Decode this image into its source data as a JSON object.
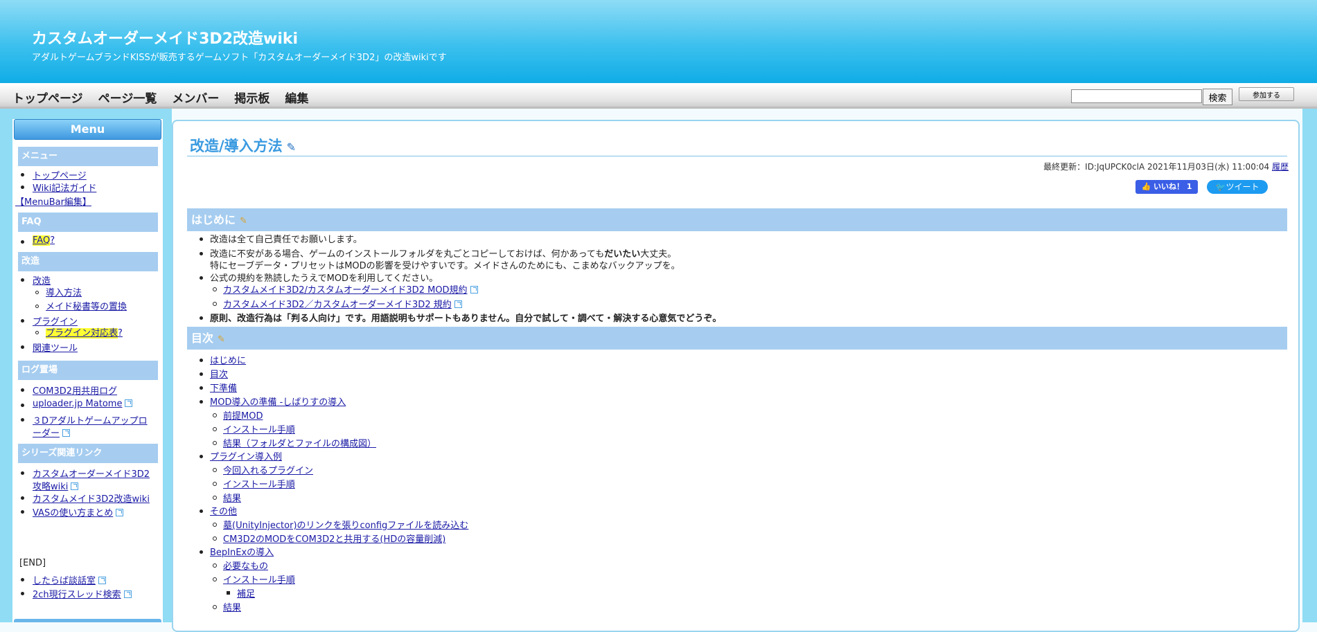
{
  "header": {
    "site_title": "カスタムオーダーメイド3D2改造wiki",
    "site_desc": "アダルトゲームブランドKISSが販売するゲームソフト「カスタムオーダーメイド3D2」の改造wikiです"
  },
  "nav": {
    "links": [
      "トップページ",
      "ページ一覧",
      "メンバー",
      "掲示板",
      "編集"
    ],
    "search_value": "",
    "search_button": "検索",
    "join_button": "参加する"
  },
  "sidebar": {
    "title": "Menu",
    "sections": [
      {
        "title": "メニュー",
        "items": [
          "トップページ",
          "Wiki記法ガイド"
        ],
        "extra": "【MenuBar編集】"
      },
      {
        "title": "FAQ",
        "items": [
          "FAQ",
          "?"
        ]
      },
      {
        "title": "改造",
        "items": [
          "改造",
          "導入方法",
          "メイド秘書等の置換",
          "プラグイン",
          "プラグイン対応表",
          "?",
          "関連ツール"
        ]
      },
      {
        "title": "ログ置場",
        "items": [
          "COM3D2用共用ログ",
          "uploader.jp Matome",
          "３Dアダルトゲームアップロ",
          "ーダー"
        ]
      },
      {
        "title": "シリーズ関連リンク",
        "items": [
          "カスタムオーダーメイド3D2",
          "攻略wiki",
          "カスタムメイド3D2改造wiki",
          "VASの使い方まとめ"
        ]
      }
    ],
    "end_label": "[END]",
    "end_items": [
      "したらば談話室",
      "2ch現行スレッド検索"
    ]
  },
  "page": {
    "title": "改造/導入方法",
    "last_update": "最終更新：ID:JqUPCK0clA 2021年11月03日(水) 11:00:04",
    "history": "履歴",
    "like_label": "いいね！ 1",
    "tweet_label": "ツイート",
    "intro_heading": "はじめに",
    "intro": {
      "b1": "改造は全て自己責任でお願いします。",
      "b2a": "改造に不安がある場合、ゲームのインストールフォルダを丸ごとコピーしておけば、何かあっても",
      "b2strong": "だいたい",
      "b2b": "大丈夫。",
      "b2line2": "特にセーブデータ・プリセットはMODの影響を受けやすいです。メイドさんのためにも、こまめなバックアップを。",
      "b3": "公式の規約を熟読したうえでMODを利用してください。",
      "link1": "カスタムメイド3D2/カスタムオーダーメイド3D2 MOD規約",
      "link2": "カスタムメイド3D2／カスタムオーダーメイド3D2 規約",
      "b4": "原則、改造行為は「判る人向け」です。用語説明もサポートもありません。自分で試して・調べて・解決する心意気でどうぞ。"
    },
    "toc_heading": "目次",
    "toc": [
      "はじめに",
      "目次",
      "下準備",
      "MOD導入の準備 -しばりすの導入",
      "前提MOD",
      "インストール手順",
      "結果（フォルダとファイルの構成図）",
      "プラグイン導入例",
      "今回入れるプラグイン",
      "インストール手順",
      "結果",
      "その他",
      "墓(UnityInjector)のリンクを張りconfigファイルを読み込む",
      "CM3D2のMODをCOM3D2と共用する(HDの容量削減)",
      "BepInExの導入",
      "必要なもの",
      "インストール手順",
      "補足",
      "結果"
    ]
  }
}
